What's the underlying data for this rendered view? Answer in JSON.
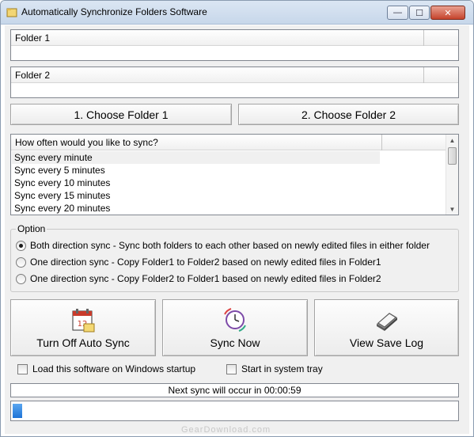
{
  "window": {
    "title": "Automatically Synchronize Folders Software",
    "controls": {
      "minimize": "—",
      "maximize": "☐",
      "close": "✕"
    }
  },
  "folder1": {
    "label": "Folder 1",
    "value": ""
  },
  "folder2": {
    "label": "Folder 2",
    "value": ""
  },
  "buttons": {
    "choose1": "1. Choose Folder 1",
    "choose2": "2. Choose Folder 2"
  },
  "sync_list": {
    "header": "How often would you like to sync?",
    "items": [
      "Sync every minute",
      "Sync every 5 minutes",
      "Sync every 10 minutes",
      "Sync every 15 minutes",
      "Sync every 20 minutes"
    ],
    "selected_index": 0
  },
  "options": {
    "label": "Option",
    "items": [
      "Both direction sync - Sync both folders to each other based on newly edited files in either folder",
      "One direction sync - Copy Folder1 to Folder2 based on newly edited files in Folder1",
      "One direction sync - Copy Folder2 to Folder1 based on newly edited files in Folder2"
    ],
    "selected_index": 0
  },
  "actions": {
    "auto_sync": "Turn Off Auto Sync",
    "sync_now": "Sync Now",
    "view_log": "View Save Log"
  },
  "checkboxes": {
    "startup": "Load this software on Windows startup",
    "tray": "Start in system tray"
  },
  "status": "Next sync will occur in 00:00:59",
  "progress": 0.02,
  "watermark": "GearDownload.com",
  "colors": {
    "progress": "#1e73d6",
    "close": "#c5432c"
  }
}
